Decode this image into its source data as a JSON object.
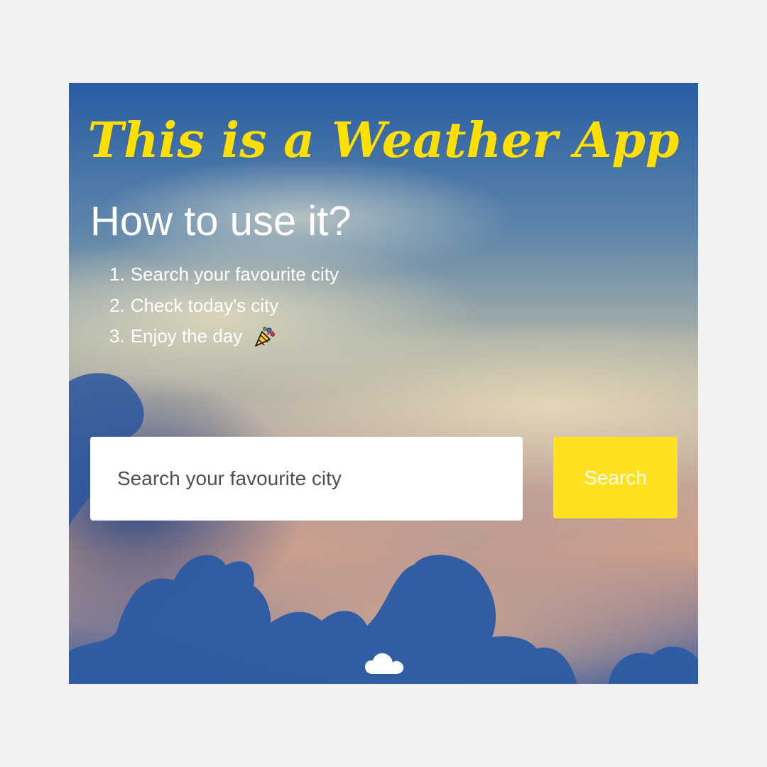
{
  "app": {
    "title": "This is a Weather App",
    "heading": "How to use it?",
    "instructions": [
      {
        "number": "1.",
        "text": "Search your favourite city"
      },
      {
        "number": "2.",
        "text": "Check today's city"
      },
      {
        "number": "3.",
        "text": "Enjoy the day",
        "icon": "party-popper-icon"
      }
    ]
  },
  "search": {
    "placeholder": "Search your favourite city",
    "button_label": "Search"
  },
  "icons": {
    "party": "party-popper-icon",
    "weather": "cloud-icon"
  },
  "colors": {
    "accent": "#ffe11f",
    "page_background": "#f1f1f1",
    "sky_blue": "#285da4",
    "text_light": "#ffffff"
  }
}
